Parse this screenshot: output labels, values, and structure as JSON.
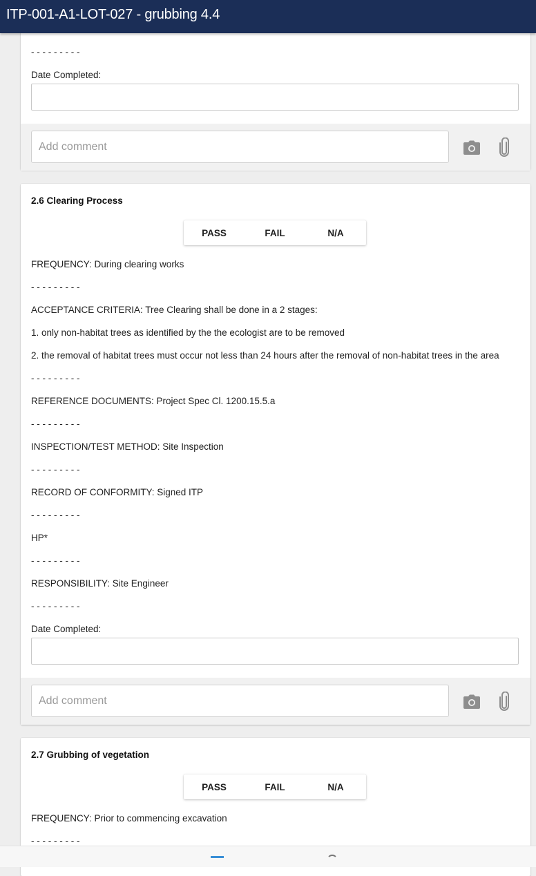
{
  "header": {
    "title": "ITP-001-A1-LOT-027 - grubbing 4.4"
  },
  "separator": "- - - - - - - - -",
  "comment_placeholder": "Add comment",
  "segment_labels": {
    "pass": "PASS",
    "fail": "FAIL",
    "na": "N/A"
  },
  "card_prev": {
    "date_label": "Date Completed:",
    "date_value": ""
  },
  "card_26": {
    "heading": "2.6 Clearing Process",
    "frequency": "FREQUENCY: During clearing works",
    "acceptance": "ACCEPTANCE CRITERIA: Tree Clearing shall be done in a 2 stages:",
    "acceptance_1": "1. only non-habitat trees as identified by the the ecologist are to be removed",
    "acceptance_2": "2. the removal of habitat trees must occur not less than 24 hours after the removal of non-habitat trees in the area",
    "reference": "REFERENCE DOCUMENTS: Project Spec Cl. 1200.15.5.a",
    "inspection": "INSPECTION/TEST METHOD: Site Inspection",
    "record": "RECORD OF CONFORMITY: Signed ITP",
    "hp": "HP*",
    "responsibility": "RESPONSIBILITY: Site Engineer",
    "date_label": "Date Completed:",
    "date_value": ""
  },
  "card_27": {
    "heading": "2.7 Grubbing of vegetation",
    "frequency": "FREQUENCY: Prior to commencing excavation"
  },
  "icons": {
    "camera": "camera-icon",
    "attach": "paperclip-icon"
  }
}
